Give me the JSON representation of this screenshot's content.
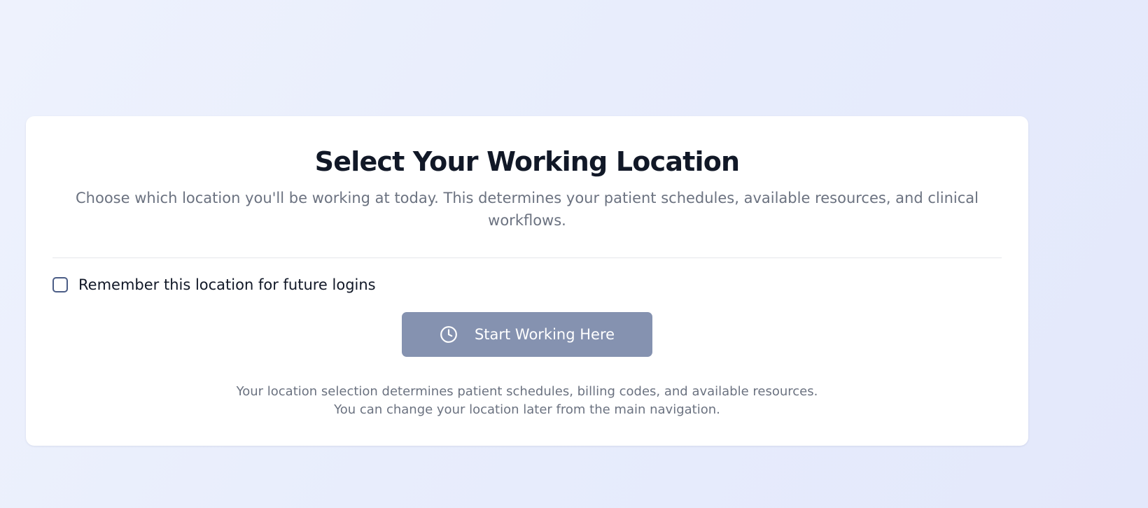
{
  "location_select": {
    "title": "Select Your Working Location",
    "subtitle": "Choose which location you'll be working at today. This determines your patient schedules, available resources, and clinical workflows.",
    "remember": {
      "label": "Remember this location for future logins",
      "checked": false
    },
    "start_button": {
      "label": "Start Working Here",
      "icon": "clock-icon",
      "disabled": true
    },
    "footnote": {
      "line1": "Your location selection determines patient schedules, billing codes, and available resources.",
      "line2": "You can change your location later from the main navigation."
    }
  },
  "colors": {
    "title": "#111827",
    "muted_text": "#6b7280",
    "button_disabled": "#8592b0",
    "checkbox_border": "#4b5d86",
    "card_bg": "#ffffff"
  }
}
